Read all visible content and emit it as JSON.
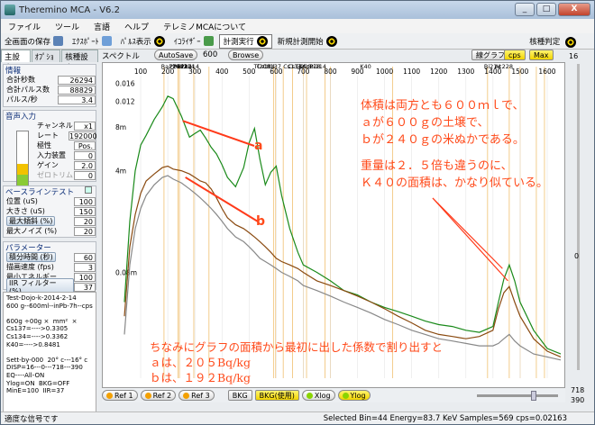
{
  "window": {
    "title": "Theremino MCA - V6.2",
    "min": "_",
    "max": "□",
    "close": "X"
  },
  "menu": [
    "ファイル",
    "ツール",
    "言語",
    "ヘルプ",
    "テレミノMCAについて"
  ],
  "toolbar": {
    "save_screen": "全画面の保存",
    "excel_export": "ｴｸｽﾎﾟｰﾄ",
    "pulse_display": "ﾊﾟﾙｽ表示",
    "equalizer": "ｲｺﾗｲｻﾞｰ",
    "run_measure": "計測実行",
    "new_measure": "新規計測開始",
    "nuclide_judge": "核種判定"
  },
  "left_tabs": [
    "主設定",
    "ｵﾌﾟｼｮﾝ",
    "核種設定"
  ],
  "info": {
    "title": "情報",
    "rows": [
      {
        "label": "合計秒数",
        "value": "26294"
      },
      {
        "label": "合計パルス数",
        "value": "88829"
      },
      {
        "label": "パルス/秒",
        "value": "3.4"
      }
    ]
  },
  "audio": {
    "title": "音声入力",
    "rows": [
      {
        "label": "チャンネル",
        "value": "x1"
      },
      {
        "label": "レート",
        "value": "192000"
      },
      {
        "label": "極性",
        "value": "Pos."
      },
      {
        "label": "入力装置",
        "value": "0"
      },
      {
        "label": "ゲイン",
        "value": "2.0"
      },
      {
        "label": "ゼロトリム",
        "value": "0"
      }
    ]
  },
  "baseline": {
    "title": "ベースラインテスト",
    "rows": [
      {
        "label": "位置 (uS)",
        "value": "100"
      },
      {
        "label": "大きさ (uS)",
        "value": "150"
      },
      {
        "label": "最大傾斜 (%)",
        "value": "20"
      },
      {
        "label": "最大ノイズ (%)",
        "value": "20"
      }
    ]
  },
  "params": {
    "title": "パラメーター",
    "rows": [
      {
        "label": "積分時間 (秒)",
        "value": "60"
      },
      {
        "label": "描画速度 (fps)",
        "value": "3"
      },
      {
        "label": "最小エネルギー",
        "value": "100"
      },
      {
        "label": "IIR フィルター (%)",
        "value": "37"
      }
    ]
  },
  "notes": "Test-Dojo-k-2014-2-14\n600 g--600ml--inPb-7h--cps\n\n600g ÷00g ×  mm²  ×\nCs137=---->0.3305\nCs134=---->0.3362\nK40=---->0.8481\n\nSett-by-000  20° c---16° c\nDISP=16---0---718---390\nEQ----All-ON\nYlog=ON  BKG=OFF\nMinE=100  IIR=37",
  "chart_head": {
    "spectrum_label": "スペクトル",
    "autosave": "AutoSave",
    "autosave_value": "600",
    "browse": "Browse",
    "line_graph": "線グラフ",
    "cps": "cps",
    "max": "Max"
  },
  "right_scroll": {
    "top": "16",
    "mid": "0",
    "b1": "718",
    "b2": "390"
  },
  "bottom_buttons": {
    "ref1": "Ref 1",
    "ref2": "Ref 2",
    "ref3": "Ref 3",
    "bkg": "BKG",
    "bkg_use": "BKG(使用)",
    "xlog": "Xlog",
    "ylog": "Ylog"
  },
  "status": {
    "left": "適度な信号です",
    "right": "Selected Bin=44  Energy=83.7 KeV  Samples=569  cps=0.02163"
  },
  "chart_data": {
    "type": "line",
    "x_ticks": [
      100,
      200,
      300,
      400,
      500,
      600,
      700,
      800,
      900,
      1000,
      1100,
      1200,
      1300,
      1400,
      1500,
      1600
    ],
    "y_ticks": [
      "0.016",
      "0.012",
      "8m",
      "4m",
      "0.08m"
    ],
    "yscale": "log",
    "nuclide_labels": [
      "Ra226",
      "Pb212",
      "Pb214",
      "Bi214",
      "Pb214",
      "Tl208",
      "Cs134",
      "Cs137",
      "Cs134",
      "Cs134",
      "Tl208",
      "Ac228",
      "Bi214",
      "K40",
      "Bi214",
      "Ac228"
    ],
    "series": [
      {
        "name": "a",
        "color": "#1a8a1a",
        "x": [
          40,
          60,
          80,
          100,
          120,
          150,
          180,
          200,
          220,
          250,
          280,
          300,
          320,
          340,
          360,
          380,
          400,
          420,
          450,
          480,
          500,
          520,
          540,
          560,
          580,
          600,
          620,
          650,
          680,
          700,
          750,
          800,
          850,
          900,
          950,
          1000,
          1050,
          1100,
          1150,
          1200,
          1250,
          1300,
          1350,
          1400,
          1420,
          1440,
          1460,
          1480,
          1500,
          1550,
          1600,
          1650
        ],
        "y": [
          0.0005,
          0.0018,
          0.004,
          0.006,
          0.007,
          0.009,
          0.011,
          0.013,
          0.0125,
          0.0095,
          0.0068,
          0.0072,
          0.0076,
          0.0067,
          0.0058,
          0.0052,
          0.0044,
          0.0036,
          0.0031,
          0.0042,
          0.0062,
          0.0078,
          0.0048,
          0.0032,
          0.0039,
          0.0043,
          0.0027,
          0.0016,
          0.0011,
          0.0009,
          0.0008,
          0.0007,
          0.0006,
          0.00056,
          0.0005,
          0.00046,
          0.00043,
          0.0004,
          0.00037,
          0.00035,
          0.00034,
          0.00032,
          0.00031,
          0.00034,
          0.0005,
          0.00072,
          0.0009,
          0.0007,
          0.0005,
          0.00032,
          0.00024,
          0.00022
        ]
      },
      {
        "name": "b",
        "color": "#8a4a10",
        "x": [
          40,
          60,
          80,
          100,
          120,
          150,
          180,
          200,
          220,
          250,
          280,
          300,
          320,
          340,
          360,
          380,
          400,
          420,
          450,
          480,
          500,
          520,
          540,
          560,
          580,
          600,
          620,
          650,
          680,
          700,
          750,
          800,
          850,
          900,
          950,
          1000,
          1050,
          1100,
          1150,
          1200,
          1250,
          1300,
          1350,
          1400,
          1420,
          1440,
          1460,
          1480,
          1500,
          1550,
          1600,
          1650
        ],
        "y": [
          0.0004,
          0.0012,
          0.002,
          0.0028,
          0.0034,
          0.0038,
          0.0042,
          0.0043,
          0.0041,
          0.004,
          0.0038,
          0.0036,
          0.0034,
          0.0033,
          0.003,
          0.0026,
          0.0022,
          0.0019,
          0.0017,
          0.0016,
          0.0015,
          0.0014,
          0.0013,
          0.0012,
          0.0011,
          0.001,
          0.00095,
          0.0009,
          0.00085,
          0.0008,
          0.0007,
          0.00065,
          0.0006,
          0.00055,
          0.0005,
          0.00045,
          0.0004,
          0.00036,
          0.00032,
          0.0003,
          0.00029,
          0.00028,
          0.00029,
          0.00032,
          0.00045,
          0.00058,
          0.00064,
          0.0005,
          0.0004,
          0.00028,
          0.00023,
          0.00021
        ]
      },
      {
        "name": "",
        "color": "#888888",
        "x": [
          40,
          60,
          80,
          100,
          120,
          150,
          180,
          200,
          220,
          250,
          280,
          300,
          320,
          340,
          360,
          380,
          400,
          420,
          450,
          480,
          500,
          520,
          540,
          560,
          580,
          600,
          620,
          650,
          680,
          700,
          750,
          800,
          850,
          900,
          950,
          1000,
          1050,
          1100,
          1150,
          1200,
          1250,
          1300,
          1350,
          1400,
          1420,
          1440,
          1460,
          1480,
          1500,
          1550,
          1600,
          1650
        ],
        "y": [
          0.0003,
          0.0009,
          0.0016,
          0.0022,
          0.0027,
          0.0032,
          0.0036,
          0.0037,
          0.0035,
          0.0033,
          0.003,
          0.0028,
          0.0026,
          0.0024,
          0.0022,
          0.002,
          0.0018,
          0.0016,
          0.0014,
          0.0013,
          0.0012,
          0.0011,
          0.001,
          0.00095,
          0.0009,
          0.00085,
          0.0008,
          0.00075,
          0.0007,
          0.00065,
          0.0006,
          0.00055,
          0.0005,
          0.00046,
          0.00042,
          0.00038,
          0.00035,
          0.00032,
          0.0003,
          0.00028,
          0.00027,
          0.00026,
          0.00025,
          0.00025,
          0.00026,
          0.00028,
          0.0003,
          0.00027,
          0.00025,
          0.00022,
          0.00021,
          0.0002
        ]
      }
    ],
    "annotations": {
      "label_a": "a",
      "label_b": "b",
      "main1": "体積は両方とも６００ｍｌで、",
      "main2": "ａが６００ｇの土壌で、",
      "main3": "ｂが２４０ｇの米ぬかである。",
      "k1": "重量は２．５倍も違うのに、",
      "k2": "Ｋ４０の面積は、かなり似ている。",
      "bottom1": "ちなみにグラフの面積から最初に出した係数で割り出すと",
      "bottom2": "ａは、２０５Bq/kg",
      "bottom3": "ｂは、１９２Bq/kg"
    }
  }
}
